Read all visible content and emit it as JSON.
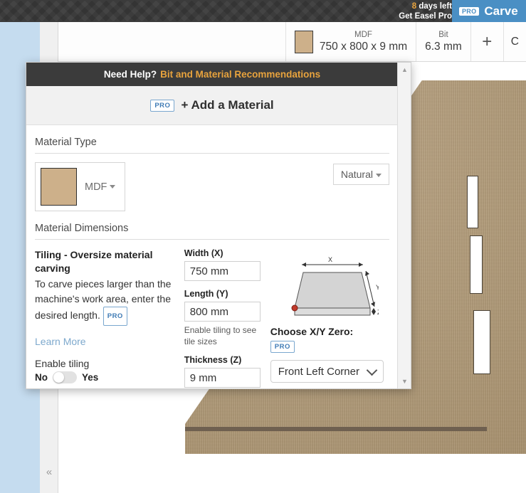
{
  "topbar": {
    "trial_days": "8",
    "trial_text": " days left",
    "trial_cta": "Get Easel Pro",
    "pro_badge": "PRO",
    "carve_label": "Carve"
  },
  "material_strip": {
    "material_name": "MDF",
    "material_dimensions": "750 x 800 x 9 mm",
    "bit_label": "Bit",
    "bit_value": "6.3 mm",
    "add_icon": "+",
    "cut_label": "C"
  },
  "modal": {
    "help_bar": {
      "question": "Need Help?",
      "link": "Bit and Material Recommendations"
    },
    "add_material": {
      "pro_badge": "PRO",
      "label": "+ Add a Material"
    },
    "material_type": {
      "section_title": "Material Type",
      "selected_material": "MDF",
      "swatch_color": "#cdb08a",
      "finish": "Natural"
    },
    "material_dimensions": {
      "section_title": "Material Dimensions",
      "tiling": {
        "heading": "Tiling - Oversize material carving",
        "description": "To carve pieces larger than the machine's work area, enter the desired length.",
        "pro_badge": "PRO",
        "learn_more": "Learn More",
        "enable_label": "Enable tiling",
        "toggle_off_label": "No",
        "toggle_on_label": "Yes",
        "toggle_state": "No"
      },
      "fields": [
        {
          "label": "Width (X)",
          "value": "750 mm"
        },
        {
          "label": "Length (Y)",
          "value": "800 mm"
        },
        {
          "label": "Thickness (Z)",
          "value": "9 mm"
        }
      ],
      "tile_hint": "Enable tiling to see tile sizes",
      "diagram": {
        "x_label": "X",
        "y_label": "Y",
        "z_label": "Z"
      },
      "zero": {
        "heading": "Choose X/Y Zero:",
        "pro_badge": "PRO",
        "selected": "Front Left Corner"
      }
    },
    "scrollbar": {
      "up": "▲",
      "down": "▼"
    }
  },
  "canvas": {
    "collapse_icon": "«"
  }
}
